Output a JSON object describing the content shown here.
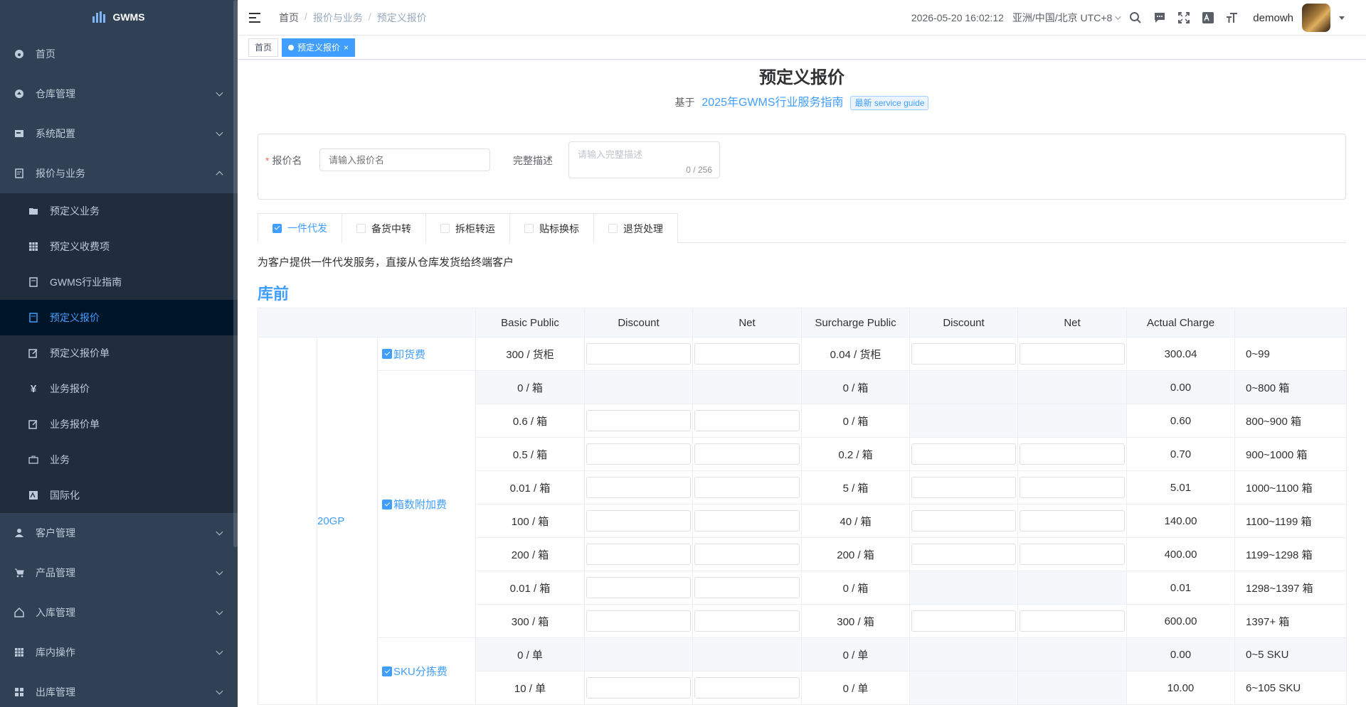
{
  "app": {
    "name": "GWMS"
  },
  "sidebar": {
    "items": [
      {
        "label": "首页",
        "icon": "dashboard-icon"
      },
      {
        "label": "仓库管理",
        "icon": "warehouse-icon"
      },
      {
        "label": "系统配置",
        "icon": "config-icon"
      },
      {
        "label": "报价与业务",
        "icon": "quote-icon"
      },
      {
        "label": "客户管理",
        "icon": "user-icon"
      },
      {
        "label": "产品管理",
        "icon": "cart-icon"
      },
      {
        "label": "入库管理",
        "icon": "home-icon"
      },
      {
        "label": "库内操作",
        "icon": "grid-icon"
      },
      {
        "label": "出库管理",
        "icon": "apps-icon"
      }
    ],
    "sub_items": [
      {
        "label": "预定义业务",
        "icon": "folder-icon"
      },
      {
        "label": "预定义收费项",
        "icon": "table-icon"
      },
      {
        "label": "GWMS行业指南",
        "icon": "guide-icon"
      },
      {
        "label": "预定义报价",
        "icon": "quote-doc-icon"
      },
      {
        "label": "预定义报价单",
        "icon": "edit-icon"
      },
      {
        "label": "业务报价",
        "icon": "yen-icon"
      },
      {
        "label": "业务报价单",
        "icon": "edit-icon"
      },
      {
        "label": "业务",
        "icon": "briefcase-icon"
      },
      {
        "label": "国际化",
        "icon": "language-icon"
      }
    ]
  },
  "navbar": {
    "breadcrumb": [
      "首页",
      "报价与业务",
      "预定义报价"
    ],
    "datetime": "2026-05-20 16:02:12",
    "timezone": "亚洲/中国/北京 UTC+8",
    "username": "demowh"
  },
  "tags": {
    "home": "首页",
    "current": "预定义报价"
  },
  "page": {
    "title": "预定义报价",
    "based_on": "基于",
    "guide_link": "2025年GWMS行业服务指南",
    "guide_badge": "最新 service guide"
  },
  "form": {
    "name_label": "报价名",
    "name_placeholder": "请输入报价名",
    "desc_label": "完整描述",
    "desc_placeholder": "请输入完整描述",
    "desc_count": "0 / 256"
  },
  "tabs": [
    "一件代发",
    "备货中转",
    "拆柜转运",
    "贴标换标",
    "退货处理"
  ],
  "tab_description": "为客户提供一件代发服务，直接从仓库发货给终端客户",
  "section_title": "库前",
  "table": {
    "headers": [
      "Basic Public",
      "Discount",
      "Net",
      "Surcharge Public",
      "Discount",
      "Net",
      "Actual Charge"
    ],
    "container": "20GP",
    "groups": {
      "unload": "卸货费",
      "box": "箱数附加费",
      "sku": "SKU分拣费"
    },
    "rows": [
      {
        "basic": "300 / 货柜",
        "surcharge": "0.04 / 货柜",
        "actual": "300.04",
        "range": "0~99",
        "inputs": true
      },
      {
        "basic": "0 / 箱",
        "surcharge": "0 / 箱",
        "actual": "0.00",
        "range": "0~800 箱",
        "inputs": false
      },
      {
        "basic": "0.6 / 箱",
        "surcharge": "0 / 箱",
        "actual": "0.60",
        "range": "800~900 箱",
        "inputs": true
      },
      {
        "basic": "0.5 / 箱",
        "surcharge": "0.2 / 箱",
        "actual": "0.70",
        "range": "900~1000 箱",
        "inputs": true
      },
      {
        "basic": "0.01 / 箱",
        "surcharge": "5 / 箱",
        "actual": "5.01",
        "range": "1000~1100 箱",
        "inputs": true
      },
      {
        "basic": "100 / 箱",
        "surcharge": "40 / 箱",
        "actual": "140.00",
        "range": "1100~1199 箱",
        "inputs": true
      },
      {
        "basic": "200 / 箱",
        "surcharge": "200 / 箱",
        "actual": "400.00",
        "range": "1199~1298 箱",
        "inputs": true
      },
      {
        "basic": "0.01 / 箱",
        "surcharge": "0 / 箱",
        "actual": "0.01",
        "range": "1298~1397 箱",
        "inputs": "basic-only"
      },
      {
        "basic": "300 / 箱",
        "surcharge": "300 / 箱",
        "actual": "600.00",
        "range": "1397+ 箱",
        "inputs": true
      },
      {
        "basic": "0 / 单",
        "surcharge": "0 / 单",
        "actual": "0.00",
        "range": "0~5 SKU",
        "inputs": false
      },
      {
        "basic": "10 / 单",
        "surcharge": "0 / 单",
        "actual": "10.00",
        "range": "6~105 SKU",
        "inputs": "basic-only"
      }
    ]
  },
  "colors": {
    "sidebar_bg": "#304156",
    "submenu_bg": "#1f2d3d",
    "accent": "#409eff"
  }
}
